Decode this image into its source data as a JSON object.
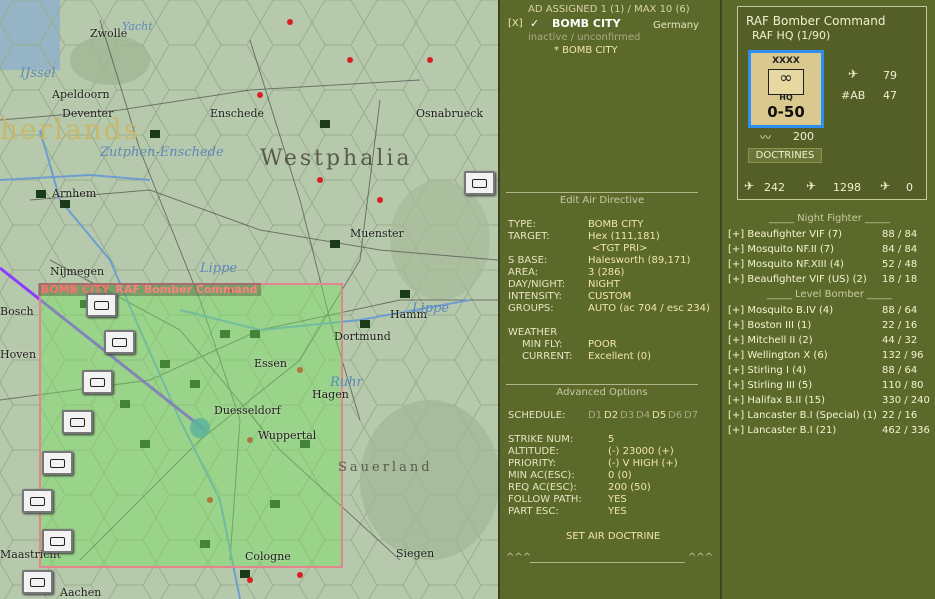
{
  "map": {
    "cities": [
      "Zwolle",
      "Apeldoorn",
      "Deventer",
      "Enschede",
      "Osnabrueck",
      "Arnhem",
      "Nijmegen",
      "Muenster",
      "Hamm",
      "Dortmund",
      "Essen",
      "Duesseldorf",
      "Wuppertal",
      "Hagen",
      "Aachen",
      "Cologne",
      "Siegen",
      "Maastricht",
      "Hoven",
      "Bosch"
    ],
    "regions": [
      "herlands",
      "Westphalia",
      "Sauerland"
    ],
    "rivers": [
      "IJssel",
      "Zutphen-Enschede",
      "Lippe",
      "Lippe",
      "Ruhr",
      "Yacht"
    ],
    "target_label": "BOMB CITY",
    "target_hq": "RAF Bomber Command"
  },
  "directive": {
    "header": "AD ASSIGNED 1 (1) / MAX 10 (6)",
    "close": "[X]",
    "title": "BOMB CITY",
    "country": "Germany",
    "status": "inactive / unconfirmed",
    "sub": "* BOMB CITY",
    "edit_header": "Edit Air Directive",
    "fields": [
      {
        "label": "TYPE:",
        "value": "BOMB CITY"
      },
      {
        "label": "TARGET:",
        "value": "Hex (111,181)"
      },
      {
        "label": "",
        "value": "<TGT PRI>"
      },
      {
        "label": "S BASE:",
        "value": "Halesworth (89,171)"
      },
      {
        "label": "AREA:",
        "value": "3 (286)"
      },
      {
        "label": "DAY/NIGHT:",
        "value": "NIGHT"
      },
      {
        "label": "INTENSITY:",
        "value": "CUSTOM"
      },
      {
        "label": "GROUPS:",
        "value": "AUTO (ac 704 / esc 234)"
      }
    ],
    "weather_label": "WEATHER",
    "min_fly_label": "MIN FLY:",
    "min_fly": "POOR",
    "current_label": "CURRENT:",
    "current": "Excellent (0)",
    "advanced_header": "Advanced Options",
    "schedule_label": "SCHEDULE:",
    "schedule_days": [
      "D1",
      "D2",
      "D3",
      "D4",
      "D5",
      "D6",
      "D7"
    ],
    "adv": [
      {
        "label": "STRIKE NUM:",
        "value": "5"
      },
      {
        "label": "ALTITUDE:",
        "value": "(-)  23000  (+)"
      },
      {
        "label": "PRIORITY:",
        "value": "(-)  V HIGH  (+)"
      },
      {
        "label": "MIN AC(ESC):",
        "value": "0 (0)"
      },
      {
        "label": "REQ AC(ESC):",
        "value": "200 (50)"
      },
      {
        "label": "FOLLOW PATH:",
        "value": "YES"
      },
      {
        "label": "PART ESC:",
        "value": "YES"
      }
    ],
    "set_doctrine": "SET AIR DOCTRINE",
    "footer_left": "^^^",
    "footer_right": "^^^"
  },
  "hq": {
    "name": "RAF Bomber Command",
    "sub": "RAF HQ  (1/90)",
    "counter_size": "XXXX",
    "counter_type": "HQ",
    "counter_range": "0-50",
    "stat1": "79",
    "ab_label": "#AB",
    "ab_value": "47",
    "stat_fuel": "200",
    "doctrines": "DOCTRINES",
    "totals": [
      "242",
      "1298",
      "0"
    ]
  },
  "groups": {
    "night_fighter_header": "_____ Night Fighter _____",
    "night_fighters": [
      {
        "btn": "[+]",
        "name": "Beaufighter VIF (7)",
        "val": "88 / 84"
      },
      {
        "btn": "[+]",
        "name": "Mosquito NF.II (7)",
        "val": "84 / 84"
      },
      {
        "btn": "[+]",
        "name": "Mosquito NF.XIII (4)",
        "val": "52 / 48"
      },
      {
        "btn": "[+]",
        "name": "Beaufighter VIF (US) (2)",
        "val": "18 / 18"
      }
    ],
    "level_bomber_header": "_____ Level Bomber _____",
    "level_bombers": [
      {
        "btn": "[+]",
        "name": "Mosquito B.IV (4)",
        "val": "88 / 64"
      },
      {
        "btn": "[+]",
        "name": "Boston III (1)",
        "val": "22 / 16"
      },
      {
        "btn": "[+]",
        "name": "Mitchell II (2)",
        "val": "44 / 32"
      },
      {
        "btn": "[+]",
        "name": "Wellington X (6)",
        "val": "132 / 96"
      },
      {
        "btn": "[+]",
        "name": "Stirling I (4)",
        "val": "88 / 64"
      },
      {
        "btn": "[+]",
        "name": "Stirling III (5)",
        "val": "110 / 80"
      },
      {
        "btn": "[+]",
        "name": "Halifax B.II (15)",
        "val": "330 / 240"
      },
      {
        "btn": "[+]",
        "name": "Lancaster B.I (Special) (1)",
        "val": "22 / 16"
      },
      {
        "btn": "[+]",
        "name": "Lancaster B.I (21)",
        "val": "462 / 336"
      }
    ]
  },
  "colors": {
    "panel": "#5b6a2b",
    "accent": "#f1e6a8",
    "target": "#e4848f",
    "path": "#8a3cff"
  }
}
